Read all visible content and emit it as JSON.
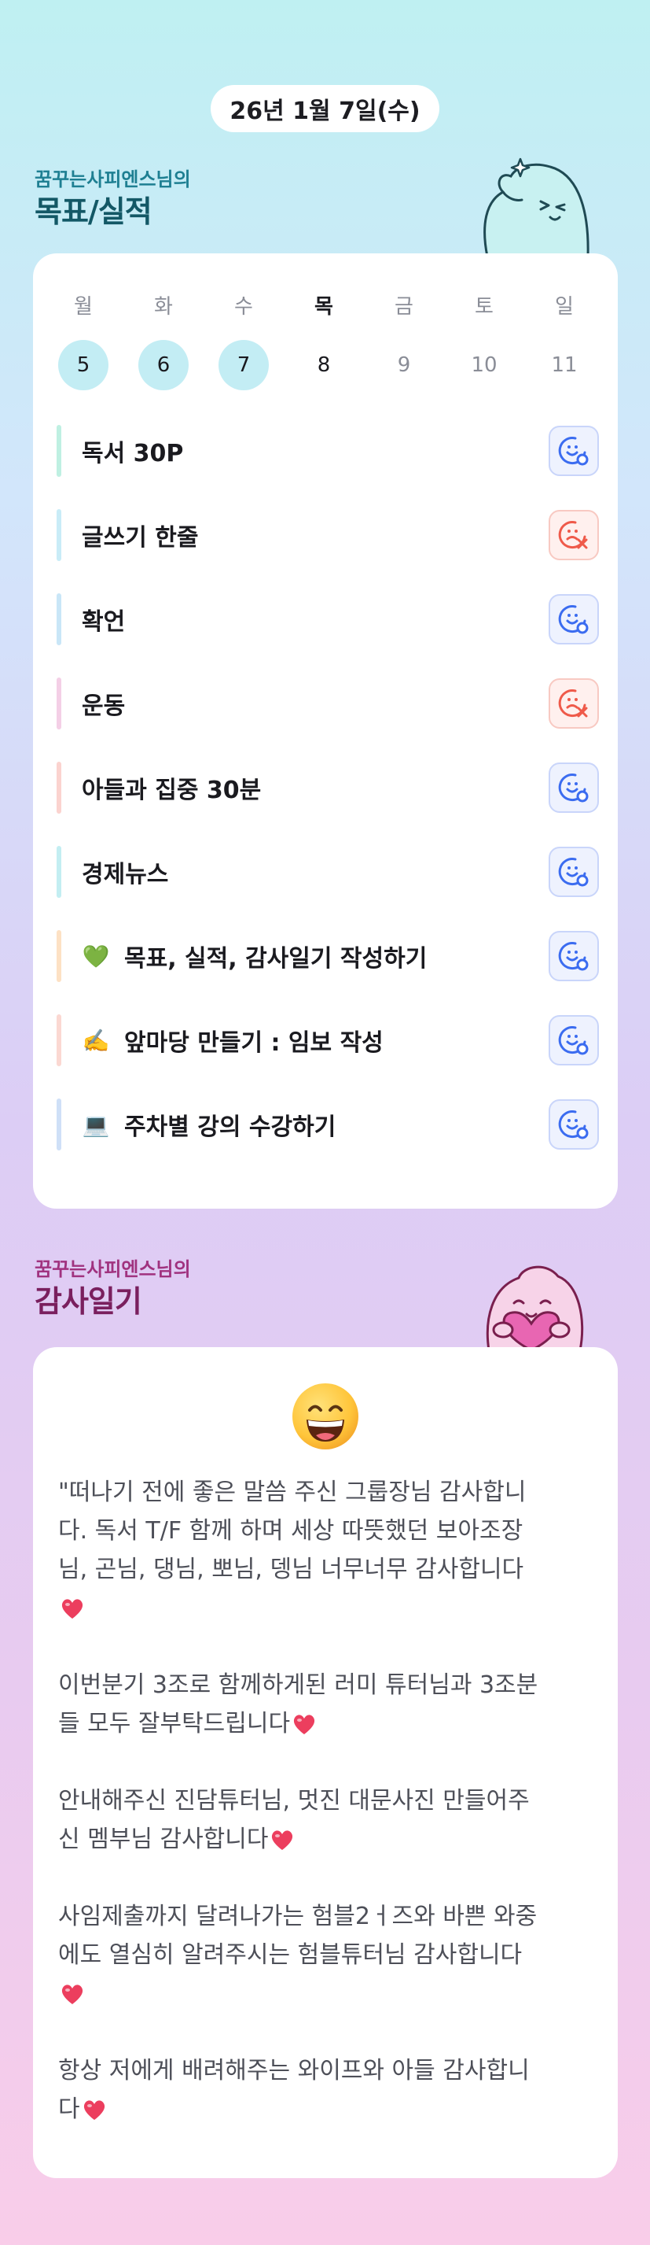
{
  "date": "26년 1월 7일(수)",
  "goals_section": {
    "subtitle": "꿈꾸는사피엔스님의",
    "title": "목표/실적"
  },
  "week": {
    "days": [
      {
        "name": "월",
        "num": "5",
        "state": "done"
      },
      {
        "name": "화",
        "num": "6",
        "state": "done"
      },
      {
        "name": "수",
        "num": "7",
        "state": "done"
      },
      {
        "name": "목",
        "num": "8",
        "state": "today"
      },
      {
        "name": "금",
        "num": "9",
        "state": "future"
      },
      {
        "name": "토",
        "num": "10",
        "state": "future"
      },
      {
        "name": "일",
        "num": "11",
        "state": "future"
      }
    ]
  },
  "goals": [
    {
      "label": "독서 30P",
      "emoji": "",
      "bar_color": "#bff0e2",
      "status": "achieved"
    },
    {
      "label": "글쓰기 한줄",
      "emoji": "",
      "bar_color": "#c9ecf7",
      "status": "failed"
    },
    {
      "label": "확언",
      "emoji": "",
      "bar_color": "#c9e6f7",
      "status": "achieved"
    },
    {
      "label": "운동",
      "emoji": "",
      "bar_color": "#f4cfe6",
      "status": "failed"
    },
    {
      "label": "아들과 집중 30분",
      "emoji": "",
      "bar_color": "#fbd3cf",
      "status": "achieved"
    },
    {
      "label": "경제뉴스",
      "emoji": "",
      "bar_color": "#c3eef2",
      "status": "achieved"
    },
    {
      "label": "목표, 실적, 감사일기 작성하기",
      "emoji": "💚",
      "bar_color": "#fde1c4",
      "status": "achieved"
    },
    {
      "label": "앞마당 만들기 : 임보 작성",
      "emoji": "✍️",
      "bar_color": "#fbd8d2",
      "status": "achieved"
    },
    {
      "label": "주차별 강의 수강하기",
      "emoji": "💻",
      "bar_color": "#cfe0f7",
      "status": "achieved"
    }
  ],
  "gratitude_section": {
    "subtitle": "꿈꾸는사피엔스님의",
    "title": "감사일기"
  },
  "gratitude": {
    "emoji": "grinning-face",
    "paragraphs": [
      {
        "text": "\"떠나기 전에 좋은 말씀 주신 그룹장님 감사합니\n다. 독서 T/F 함께 하며 세상 따뜻했던 보아조장\n님, 곤님, 댕님, 뽀님, 뎅님 너무너무 감사합니다\n",
        "heart": true
      },
      {
        "text": "이번분기 3조로 함께하게된 러미 튜터님과 3조분\n들 모두 잘부탁드립니다",
        "heart": true
      },
      {
        "text": "안내해주신 진담튜터님, 멋진 대문사진 만들어주\n신 멤부님 감사합니다",
        "heart": true
      },
      {
        "text": "사임제출까지 달려나가는 험블2ㅓ즈와 바쁜 와중\n에도 열심히 알려주시는 험블튜터님 감사합니다\n",
        "heart": true
      },
      {
        "text": "항상 저에게 배려해주는 와이프와 아들 감사합니\n다",
        "heart": true
      }
    ]
  },
  "colors": {
    "achieved_icon": "#3b6cf0",
    "failed_icon": "#ef5a4a",
    "done_day_bg": "#c3edf4",
    "heart": "#ec3e5e"
  }
}
